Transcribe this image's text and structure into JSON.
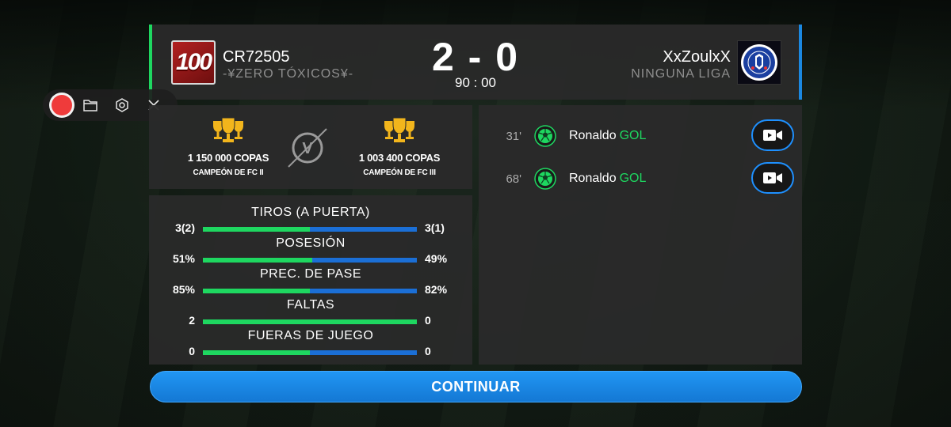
{
  "match": {
    "home": {
      "name": "CR72505",
      "club": "-¥ZERO TÓXICOS¥-",
      "badge_text": "100",
      "accent": "#1ed760"
    },
    "away": {
      "name": "XxZoulxX",
      "club": "NINGUNA LIGA",
      "accent": "#1b88e0"
    },
    "score": "2 - 0",
    "time": "90 : 00"
  },
  "trophies": {
    "home": {
      "cups": "1 150 000 COPAS",
      "title": "CAMPEÓN DE FC II"
    },
    "away": {
      "cups": "1 003 400 COPAS",
      "title": "CAMPEÓN DE FC III"
    },
    "vs_label": "V"
  },
  "stats": [
    {
      "label": "TIROS (A PUERTA)",
      "home": "3(2)",
      "away": "3(1)",
      "home_share": 0.5
    },
    {
      "label": "POSESIÓN",
      "home": "51%",
      "away": "49%",
      "home_share": 0.51
    },
    {
      "label": "PREC. DE PASE",
      "home": "85%",
      "away": "82%",
      "home_share": 0.5
    },
    {
      "label": "FALTAS",
      "home": "2",
      "away": "0",
      "home_share": 1.0
    },
    {
      "label": "FUERAS DE JUEGO",
      "home": "0",
      "away": "0",
      "home_share": 0.5
    }
  ],
  "events": [
    {
      "minute": "31'",
      "player": "Ronaldo",
      "type": "GOL"
    },
    {
      "minute": "68'",
      "player": "Ronaldo",
      "type": "GOL"
    }
  ],
  "continue_label": "CONTINUAR",
  "colors": {
    "home_bar": "#1ed760",
    "away_bar": "#1b6fd6",
    "button": "#1e90ff"
  }
}
